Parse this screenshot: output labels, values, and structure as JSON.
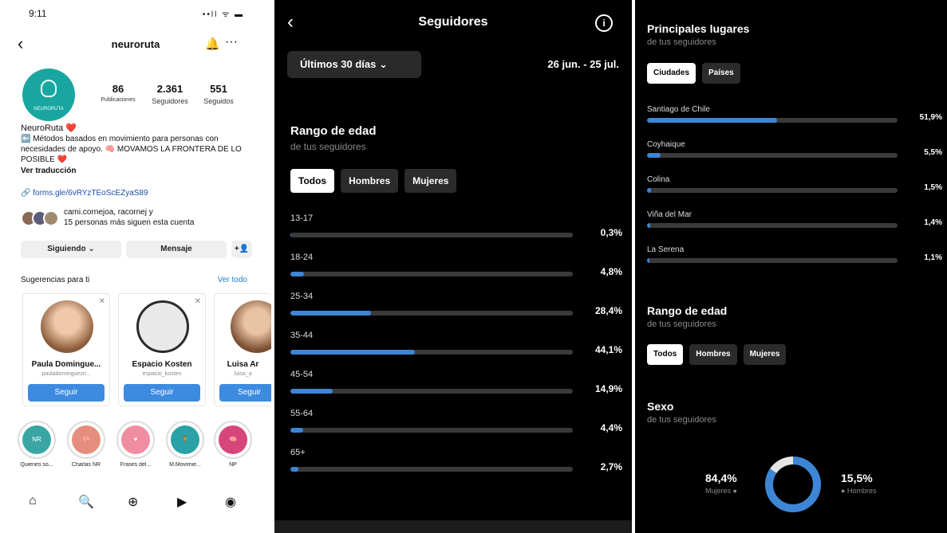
{
  "profile": {
    "status": {
      "time": "9:11",
      "icons": "••ll ᯤ ▬"
    },
    "username": "neuroruta",
    "avatar_text": "NEURORUTA",
    "stats": [
      {
        "value": "86",
        "label": "Publicaciones"
      },
      {
        "value": "2.361",
        "label": "Seguidores"
      },
      {
        "value": "551",
        "label": "Seguidos"
      }
    ],
    "bio": {
      "name": "NeuroRuta ❤️",
      "text": "⬅️ Métodos basados en movimiento para personas con necesidades de apoyo. 🧠 MOVAMOS LA FRONTERA DE LO POSIBLE ❤️",
      "translate": "Ver traducción"
    },
    "link": "🔗 forms.gle/6vRYzTEoScEZyaS89",
    "mutual_line1": "cami.cornejoa, racornej y",
    "mutual_line2": "15 personas más siguen esta cuenta",
    "buttons": {
      "following": "Siguiendo ⌄",
      "message": "Mensaje",
      "add_user": "+👤"
    },
    "suggestions_title": "Sugerencias para ti",
    "see_all": "Ver todo",
    "suggestions": [
      {
        "name": "Paula Domingue...",
        "user": "pauladominguezri...",
        "follow": "Seguir",
        "color": "#c98a5f"
      },
      {
        "name": "Espacio Kosten",
        "user": "espacio_kosten",
        "follow": "Seguir",
        "color": "#d7d7d7"
      },
      {
        "name": "Luisa Ar",
        "user": "luisa_a",
        "follow": "Seguir",
        "color": "#b47a55"
      }
    ],
    "highlights": [
      {
        "label": "Quienes so...",
        "icon": "NR",
        "color": "#3aa6a4"
      },
      {
        "label": "Charlas NR",
        "icon": "🧠",
        "color": "#e58e7d"
      },
      {
        "label": "Frases del...",
        "icon": "♥",
        "color": "#f08da0"
      },
      {
        "label": "M.Movimie...",
        "icon": "🧍",
        "color": "#2aa2a7"
      },
      {
        "label": "NP",
        "icon": "🧠",
        "color": "#d6467a"
      }
    ],
    "tabbar": [
      "⌂",
      "🔍",
      "⊕",
      "▶",
      "◉"
    ]
  },
  "followers": {
    "title": "Seguidores",
    "info_icon": "i",
    "range": "Últimos 30 días ⌄",
    "dates": "26 jun. - 25 jul.",
    "age_title": "Rango de edad",
    "age_subtitle": "de tus seguidores",
    "tabs": [
      "Todos",
      "Hombres",
      "Mujeres"
    ],
    "age_groups": [
      {
        "label": "13-17",
        "value": 0.3,
        "display": "0,3%"
      },
      {
        "label": "18-24",
        "value": 4.8,
        "display": "4,8%"
      },
      {
        "label": "25-34",
        "value": 28.4,
        "display": "28,4%"
      },
      {
        "label": "35-44",
        "value": 44.1,
        "display": "44,1%"
      },
      {
        "label": "45-54",
        "value": 14.9,
        "display": "14,9%"
      },
      {
        "label": "55-64",
        "value": 4.4,
        "display": "4,4%"
      },
      {
        "label": "65+",
        "value": 2.7,
        "display": "2,7%"
      }
    ]
  },
  "places": {
    "title": "Principales lugares",
    "subtitle": "de tus seguidores",
    "tabs": [
      "Ciudades",
      "Países"
    ],
    "cities": [
      {
        "label": "Santiago de Chile",
        "value": 51.9,
        "display": "51,9%"
      },
      {
        "label": "Coyhaique",
        "value": 5.5,
        "display": "5,5%"
      },
      {
        "label": "Colina",
        "value": 1.5,
        "display": "1,5%"
      },
      {
        "label": "Viña del Mar",
        "value": 1.4,
        "display": "1,4%"
      },
      {
        "label": "La Serena",
        "value": 1.1,
        "display": "1,1%"
      }
    ],
    "age_title": "Rango de edad",
    "age_subtitle": "de tus seguidores",
    "age_tabs": [
      "Todos",
      "Hombres",
      "Mujeres"
    ],
    "sex_title": "Sexo",
    "sex_subtitle": "de tus seguidores",
    "women": {
      "value": 84.4,
      "display": "84,4%",
      "label": "Mujeres ●"
    },
    "men": {
      "value": 15.5,
      "display": "15,5%",
      "label": "● Hombres"
    }
  },
  "colors": {
    "accent": "#3d86d6",
    "track": "#3a3a3a",
    "bg_dark": "#000000"
  }
}
